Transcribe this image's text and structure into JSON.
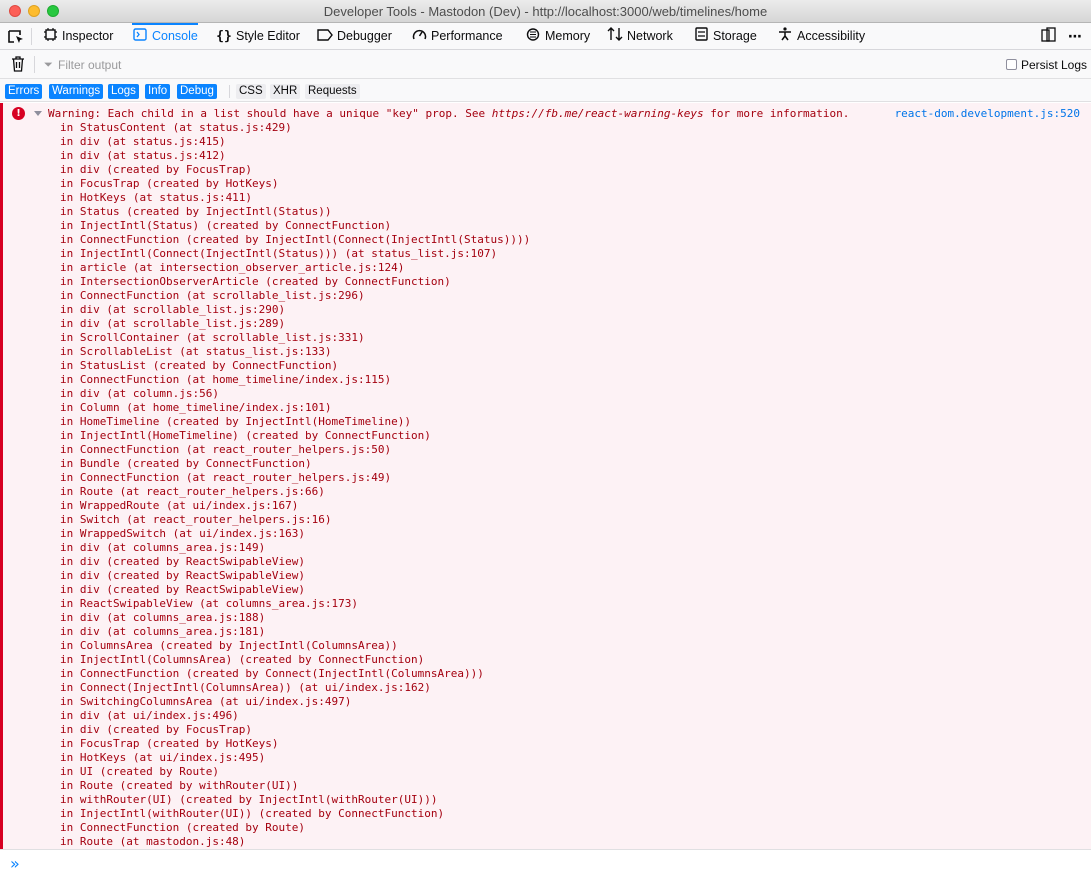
{
  "window": {
    "title": "Developer Tools - Mastodon (Dev) - http://localhost:3000/web/timelines/home"
  },
  "toolbox": {
    "tabs": [
      {
        "label": "Inspector",
        "icon": "inspector-icon"
      },
      {
        "label": "Console",
        "icon": "console-icon",
        "selected": true
      },
      {
        "label": "Style Editor",
        "icon": "braces-icon"
      },
      {
        "label": "Debugger",
        "icon": "debugger-icon"
      },
      {
        "label": "Performance",
        "icon": "gauge-icon"
      },
      {
        "label": "Memory",
        "icon": "memory-icon"
      },
      {
        "label": "Network",
        "icon": "network-arrows-icon"
      },
      {
        "label": "Storage",
        "icon": "storage-icon"
      },
      {
        "label": "Accessibility",
        "icon": "accessibility-icon"
      }
    ]
  },
  "filter": {
    "placeholder": "Filter output",
    "persist_logs_label": "Persist Logs"
  },
  "levels": [
    {
      "label": "Errors",
      "active": true
    },
    {
      "label": "Warnings",
      "active": true
    },
    {
      "label": "Logs",
      "active": true
    },
    {
      "label": "Info",
      "active": true
    },
    {
      "label": "Debug",
      "active": true
    },
    {
      "label": "CSS",
      "active": false
    },
    {
      "label": "XHR",
      "active": false
    },
    {
      "label": "Requests",
      "active": false
    }
  ],
  "message": {
    "prefix": "Warning: Each child in a list should have a unique \"key\" prop. See ",
    "link": "https://fb.me/react-warning-keys",
    "suffix": " for more information.",
    "location": "react-dom.development.js:520",
    "stack": [
      "in StatusContent (at status.js:429)",
      "in div (at status.js:415)",
      "in div (at status.js:412)",
      "in div (created by FocusTrap)",
      "in FocusTrap (created by HotKeys)",
      "in HotKeys (at status.js:411)",
      "in Status (created by InjectIntl(Status))",
      "in InjectIntl(Status) (created by ConnectFunction)",
      "in ConnectFunction (created by InjectIntl(Connect(InjectIntl(Status))))",
      "in InjectIntl(Connect(InjectIntl(Status))) (at status_list.js:107)",
      "in article (at intersection_observer_article.js:124)",
      "in IntersectionObserverArticle (created by ConnectFunction)",
      "in ConnectFunction (at scrollable_list.js:296)",
      "in div (at scrollable_list.js:290)",
      "in div (at scrollable_list.js:289)",
      "in ScrollContainer (at scrollable_list.js:331)",
      "in ScrollableList (at status_list.js:133)",
      "in StatusList (created by ConnectFunction)",
      "in ConnectFunction (at home_timeline/index.js:115)",
      "in div (at column.js:56)",
      "in Column (at home_timeline/index.js:101)",
      "in HomeTimeline (created by InjectIntl(HomeTimeline))",
      "in InjectIntl(HomeTimeline) (created by ConnectFunction)",
      "in ConnectFunction (at react_router_helpers.js:50)",
      "in Bundle (created by ConnectFunction)",
      "in ConnectFunction (at react_router_helpers.js:49)",
      "in Route (at react_router_helpers.js:66)",
      "in WrappedRoute (at ui/index.js:167)",
      "in Switch (at react_router_helpers.js:16)",
      "in WrappedSwitch (at ui/index.js:163)",
      "in div (at columns_area.js:149)",
      "in div (created by ReactSwipableView)",
      "in div (created by ReactSwipableView)",
      "in div (created by ReactSwipableView)",
      "in ReactSwipableView (at columns_area.js:173)",
      "in div (at columns_area.js:188)",
      "in div (at columns_area.js:181)",
      "in ColumnsArea (created by InjectIntl(ColumnsArea))",
      "in InjectIntl(ColumnsArea) (created by ConnectFunction)",
      "in ConnectFunction (created by Connect(InjectIntl(ColumnsArea)))",
      "in Connect(InjectIntl(ColumnsArea)) (at ui/index.js:162)",
      "in SwitchingColumnsArea (at ui/index.js:497)",
      "in div (at ui/index.js:496)",
      "in div (created by FocusTrap)",
      "in FocusTrap (created by HotKeys)",
      "in HotKeys (at ui/index.js:495)",
      "in UI (created by Route)",
      "in Route (created by withRouter(UI))",
      "in withRouter(UI) (created by InjectIntl(withRouter(UI)))",
      "in InjectIntl(withRouter(UI)) (created by ConnectFunction)",
      "in ConnectFunction (created by Route)",
      "in Route (at mastodon.js:48)"
    ]
  },
  "input": {
    "prompt_icon": "double-chevron-icon"
  },
  "colors": {
    "accent": "#0a84ff",
    "error": "#d70022",
    "error_text": "#a4000f",
    "error_bg": "#fdf2f5"
  }
}
